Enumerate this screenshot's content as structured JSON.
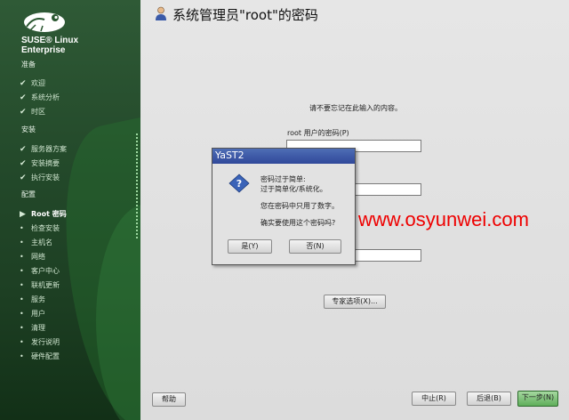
{
  "sidebar": {
    "brand_line1": "SUSE® Linux",
    "brand_line2": "Enterprise",
    "sections": [
      {
        "label": "准备",
        "steps": [
          {
            "label": "欢迎",
            "mark": "✔"
          },
          {
            "label": "系统分析",
            "mark": "✔"
          },
          {
            "label": "时区",
            "mark": "✔"
          }
        ]
      },
      {
        "label": "安装",
        "steps": [
          {
            "label": "服务器方案",
            "mark": "✔"
          },
          {
            "label": "安装摘要",
            "mark": "✔"
          },
          {
            "label": "执行安装",
            "mark": "✔"
          }
        ]
      },
      {
        "label": "配置",
        "steps": [
          {
            "label": "Root 密码",
            "mark": "▶"
          },
          {
            "label": "检查安装",
            "mark": "•"
          },
          {
            "label": "主机名",
            "mark": "•"
          },
          {
            "label": "网络",
            "mark": "•"
          },
          {
            "label": "客户中心",
            "mark": "•"
          },
          {
            "label": "联机更新",
            "mark": "•"
          },
          {
            "label": "服务",
            "mark": "•"
          },
          {
            "label": "用户",
            "mark": "•"
          },
          {
            "label": "清理",
            "mark": "•"
          },
          {
            "label": "发行说明",
            "mark": "•"
          },
          {
            "label": "硬件配置",
            "mark": "•"
          }
        ]
      }
    ]
  },
  "main": {
    "title": "系统管理员\"root\"的密码",
    "reminder": "请不要忘记在此输入的内容。",
    "password_label": "root 用户的密码(P)",
    "expert_button": "专家选项(X)...",
    "help_button": "帮助",
    "abort_button": "中止(R)",
    "back_button": "后退(B)",
    "next_button": "下一步(N)"
  },
  "dialog": {
    "title": "YaST2",
    "line1": "密码过于简单:",
    "line2": "过于简单化/系统化。",
    "line3": "您在密码中只用了数字。",
    "line4": "确实要使用这个密码吗?",
    "yes_button": "是(Y)",
    "no_button": "否(N)"
  },
  "watermark": "www.osyunwei.com",
  "colors": {
    "sidebar_bg": "#23492a",
    "dialog_titlebar": "#3a55a5",
    "watermark": "#ee0000",
    "next_button": "#6cb866"
  }
}
